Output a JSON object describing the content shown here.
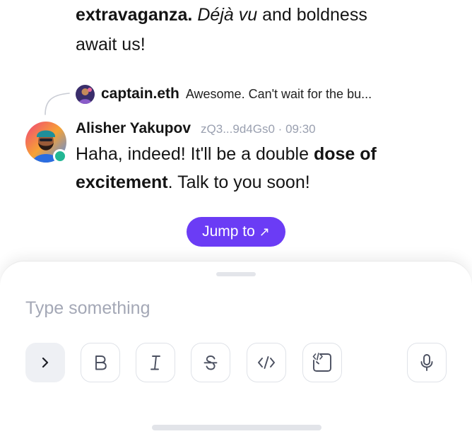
{
  "previous_message": {
    "bold_word": "extravaganza.",
    "italic_phrase": "Déjà vu",
    "rest_line1": " and boldness",
    "line2": "await us!"
  },
  "reply_preview": {
    "author": "captain.eth",
    "snippet": "Awesome. Can't wait for the bu..."
  },
  "message": {
    "author": "Alisher Yakupov",
    "wallet": "zQ3...9d4Gs0",
    "separator": "·",
    "time": "09:30",
    "text_part1": "Haha, indeed! It'll be a double ",
    "text_bold": "dose of excitement",
    "text_part2": ". Talk to you soon!"
  },
  "jump_button": {
    "label": "Jump to",
    "arrow": "↗"
  },
  "composer": {
    "placeholder": "Type something",
    "value": "",
    "toolbar": {
      "expand_icon": "chevron-right-icon",
      "bold_icon": "bold-icon",
      "italic_icon": "italic-icon",
      "strike_icon": "strikethrough-icon",
      "code_icon": "code-icon",
      "codeblock_icon": "code-block-icon",
      "mic_icon": "microphone-icon"
    }
  },
  "colors": {
    "accent": "#6b3cf5",
    "online": "#22b794",
    "meta_text": "#9aa0b0",
    "placeholder": "#a4a8b6"
  }
}
